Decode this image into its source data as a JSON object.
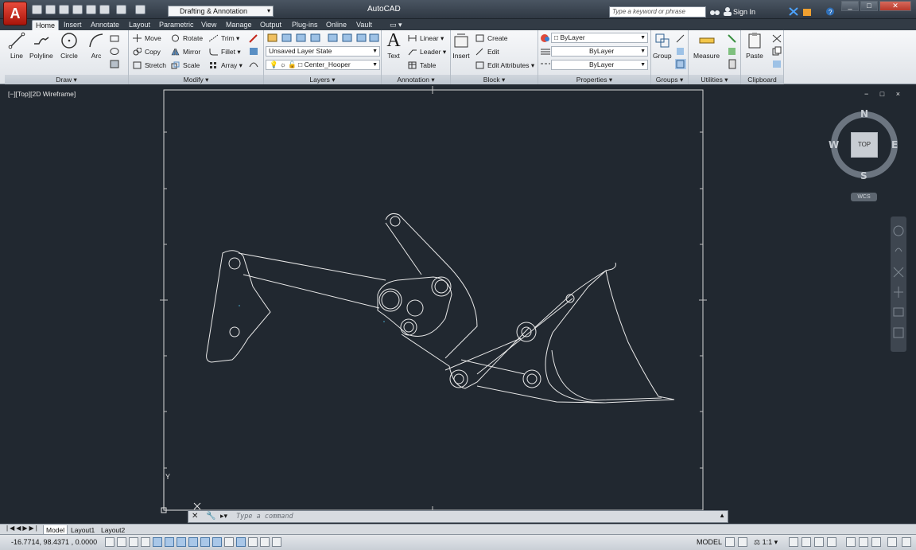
{
  "titlebar": {
    "app_title": "AutoCAD",
    "workspace": "Drafting & Annotation",
    "search_placeholder": "Type a keyword or phrase",
    "signin": "Sign In",
    "logo_letter": "A"
  },
  "tabs": [
    "Home",
    "Insert",
    "Annotate",
    "Layout",
    "Parametric",
    "View",
    "Manage",
    "Output",
    "Plug-ins",
    "Online",
    "Vault"
  ],
  "ribbon": {
    "draw": {
      "title": "Draw",
      "line": "Line",
      "polyline": "Polyline",
      "circle": "Circle",
      "arc": "Arc"
    },
    "modify": {
      "title": "Modify",
      "move": "Move",
      "rotate": "Rotate",
      "trim": "Trim",
      "copy": "Copy",
      "mirror": "Mirror",
      "fillet": "Fillet",
      "stretch": "Stretch",
      "scale": "Scale",
      "array": "Array"
    },
    "layers": {
      "title": "Layers",
      "layer_state": "Unsaved Layer State",
      "current_layer": "Center_Hooper"
    },
    "annotation": {
      "title": "Annotation",
      "text": "Text",
      "linear": "Linear",
      "leader": "Leader",
      "table": "Table"
    },
    "block": {
      "title": "Block",
      "insert": "Insert",
      "create": "Create",
      "edit": "Edit",
      "edit_attributes": "Edit Attributes"
    },
    "properties": {
      "title": "Properties",
      "color": "ByLayer",
      "linetype": "ByLayer",
      "lineweight": "ByLayer"
    },
    "groups": {
      "title": "Groups",
      "group": "Group"
    },
    "utilities": {
      "title": "Utilities",
      "measure": "Measure"
    },
    "clipboard": {
      "title": "Clipboard",
      "paste": "Paste"
    }
  },
  "viewport": {
    "label": "[−][Top][2D Wireframe]",
    "controls": "− □ ×"
  },
  "viewcube": {
    "n": "N",
    "s": "S",
    "e": "E",
    "w": "W",
    "face": "TOP",
    "ucs": "WCS"
  },
  "ucs_axis": {
    "y": "Y",
    "x": "X"
  },
  "command": {
    "placeholder": "Type a command"
  },
  "layout_tabs": [
    "Model",
    "Layout1",
    "Layout2"
  ],
  "status": {
    "coords": "-16.7714, 98.4371 , 0.0000",
    "model": "MODEL",
    "scale": "1:1"
  },
  "colors": {
    "canvas": "#212830",
    "drawing_lines": "#e8e8e8",
    "accent_red": "#c4261a"
  }
}
